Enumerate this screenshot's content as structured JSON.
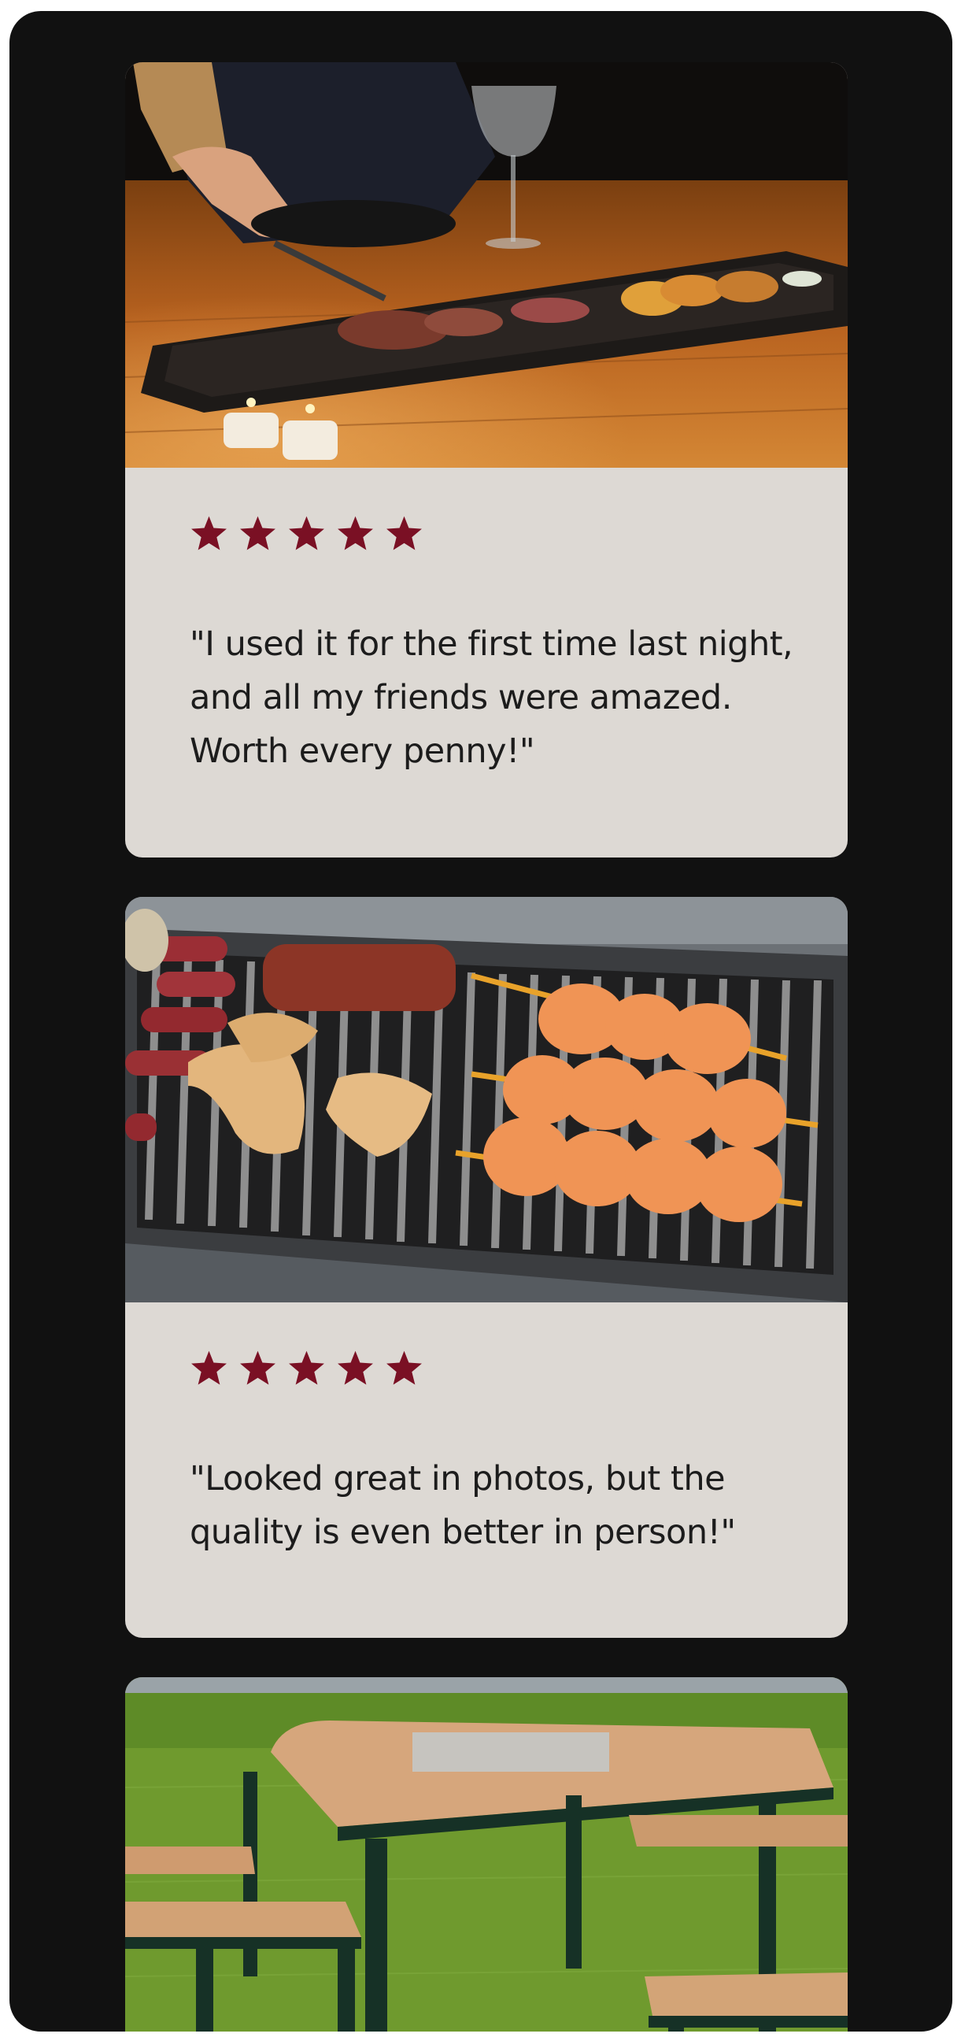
{
  "reviews": [
    {
      "rating": 5,
      "quote": "\"I used it for the first time last night, and all my friends were amazed. Worth every penny!\"",
      "photo_icon": "bbq-table-dinner-photo"
    },
    {
      "rating": 5,
      "quote": "\"Looked great in photos, but the quality is even better in person!\"",
      "photo_icon": "grill-skewers-photo"
    },
    {
      "photo_icon": "outdoor-fire-table-photo"
    }
  ],
  "colors": {
    "background": "#111111",
    "card": "#ddd9d4",
    "star": "#7a1024",
    "text": "#1c1c1c"
  }
}
